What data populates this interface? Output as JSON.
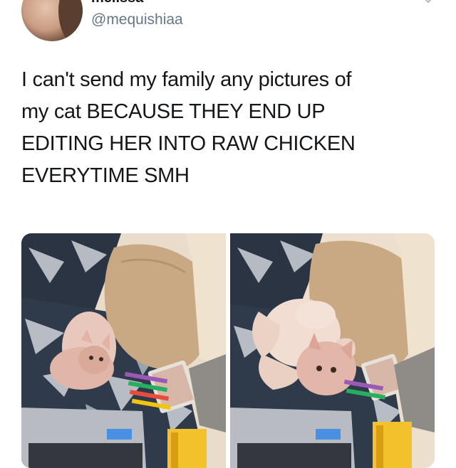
{
  "author": {
    "display_name": "melissa",
    "handle": "@mequishiaa"
  },
  "tweet": {
    "lines": [
      "I can't send my family any pictures of",
      "my cat BECAUSE THEY END UP",
      "EDITING HER INTO RAW CHICKEN",
      "EVERYTIME SMH"
    ]
  },
  "media": {
    "photos": [
      {
        "subject": "hairless cat curled on blanket"
      },
      {
        "subject": "hairless cat edited into raw chicken"
      }
    ]
  }
}
